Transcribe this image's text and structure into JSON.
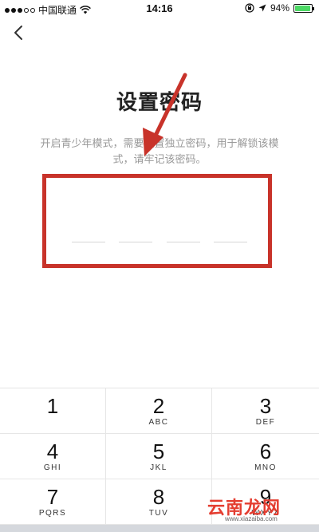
{
  "status_bar": {
    "carrier": "中国联通",
    "time": "14:16",
    "battery_percent": "94%",
    "battery_level": 0.94
  },
  "nav": {
    "back_icon": "chevron-left-icon"
  },
  "main": {
    "title": "设置密码",
    "description": "开启青少年模式，需要设置独立密码，用于解锁该模式，请牢记该密码。",
    "pin_length": 4
  },
  "annotation": {
    "arrow_color": "#c8332a",
    "box_color": "#c8332a"
  },
  "keypad": {
    "keys": [
      {
        "digit": "1",
        "letters": ""
      },
      {
        "digit": "2",
        "letters": "ABC"
      },
      {
        "digit": "3",
        "letters": "DEF"
      },
      {
        "digit": "4",
        "letters": "GHI"
      },
      {
        "digit": "5",
        "letters": "JKL"
      },
      {
        "digit": "6",
        "letters": "MNO"
      },
      {
        "digit": "7",
        "letters": "PQRS"
      },
      {
        "digit": "8",
        "letters": "TUV"
      },
      {
        "digit": "9",
        "letters": "WXYZ"
      }
    ]
  },
  "watermark": {
    "text": "云南龙网",
    "url": "www.xiazaiba.com"
  }
}
